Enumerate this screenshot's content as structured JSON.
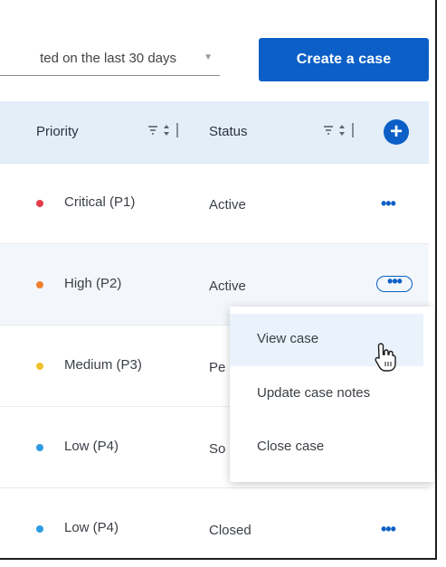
{
  "toolbar": {
    "filter_value": "ted on the last 30 days",
    "create_label": "Create a case"
  },
  "table": {
    "headers": [
      {
        "label": "Priority"
      },
      {
        "label": "Status"
      }
    ],
    "rows": [
      {
        "priority": "Critical (P1)",
        "status": "Active",
        "dot_color": "#e33b4a"
      },
      {
        "priority": "High (P2)",
        "status": "Active",
        "dot_color": "#f0812e"
      },
      {
        "priority": "Medium (P3)",
        "status": "Pe",
        "dot_color": "#f2c230"
      },
      {
        "priority": "Low (P4)",
        "status": "So",
        "dot_color": "#2d9be1"
      },
      {
        "priority": "Low (P4)",
        "status": "Closed",
        "dot_color": "#2d9be1"
      }
    ]
  },
  "menu": {
    "items": [
      "View case",
      "Update case notes",
      "Close case"
    ]
  },
  "icons": {
    "filter_sort": "⩸ ⇕ |",
    "add": "+",
    "more": "•••"
  },
  "colors": {
    "accent": "#0b5fc6",
    "header_bg": "#e3eef9"
  }
}
